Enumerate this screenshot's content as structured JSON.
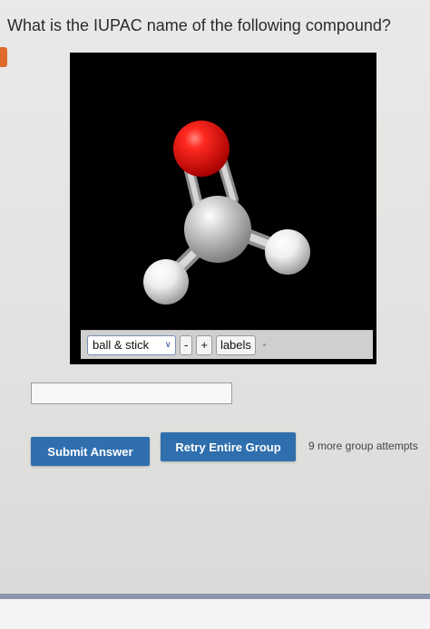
{
  "question": {
    "text": "What is the IUPAC name of the following compound?"
  },
  "viewer": {
    "mode_select": "ball & stick",
    "zoom_out_label": "-",
    "zoom_in_label": "+",
    "labels_button": "labels",
    "atoms": [
      {
        "element": "O",
        "color": "#e51414"
      },
      {
        "element": "C",
        "color": "#c8c8c8"
      },
      {
        "element": "H",
        "color": "#f0f0f0"
      },
      {
        "element": "H",
        "color": "#f0f0f0"
      }
    ],
    "bonds": [
      "C=O",
      "C-H",
      "C-H"
    ]
  },
  "answer": {
    "value": "",
    "placeholder": ""
  },
  "actions": {
    "submit_label": "Submit Answer",
    "retry_label": "Retry Entire Group",
    "attempts_text": "9 more group attempts"
  },
  "colors": {
    "accent_blue": "#2f6fae",
    "tab_orange": "#e06a2a"
  }
}
